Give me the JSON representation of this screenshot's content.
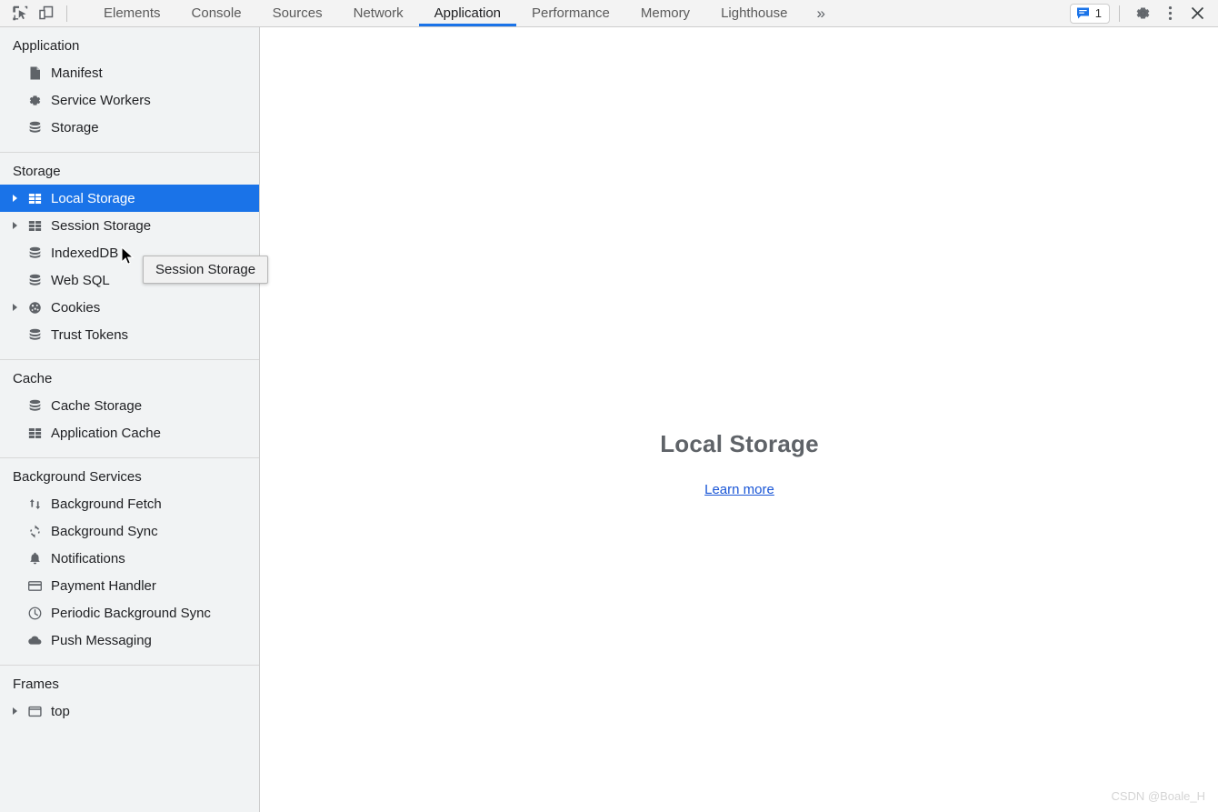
{
  "toolbar": {
    "inspect_icon": "inspect-element-icon",
    "device_icon": "device-toolbar-icon",
    "tabs": [
      {
        "label": "Elements",
        "active": false
      },
      {
        "label": "Console",
        "active": false
      },
      {
        "label": "Sources",
        "active": false
      },
      {
        "label": "Network",
        "active": false
      },
      {
        "label": "Application",
        "active": true
      },
      {
        "label": "Performance",
        "active": false
      },
      {
        "label": "Memory",
        "active": false
      },
      {
        "label": "Lighthouse",
        "active": false
      }
    ],
    "more_tabs_label": "»",
    "message_count": "1",
    "message_icon": "message-bubble-icon",
    "settings_icon": "gear-icon",
    "more_icon": "kebab-menu-icon",
    "close_icon": "close-icon",
    "accent_color": "#1a73e8"
  },
  "sidebar": {
    "sections": [
      {
        "title": "Application",
        "items": [
          {
            "label": "Manifest",
            "icon": "manifest-document-icon",
            "twisty": false,
            "selected": false
          },
          {
            "label": "Service Workers",
            "icon": "gear-icon",
            "twisty": false,
            "selected": false
          },
          {
            "label": "Storage",
            "icon": "database-stack-icon",
            "twisty": false,
            "selected": false
          }
        ]
      },
      {
        "title": "Storage",
        "items": [
          {
            "label": "Local Storage",
            "icon": "table-grid-icon",
            "twisty": true,
            "selected": true
          },
          {
            "label": "Session Storage",
            "icon": "table-grid-icon",
            "twisty": true,
            "selected": false
          },
          {
            "label": "IndexedDB",
            "icon": "database-stack-icon",
            "twisty": false,
            "selected": false
          },
          {
            "label": "Web SQL",
            "icon": "database-stack-icon",
            "twisty": false,
            "selected": false
          },
          {
            "label": "Cookies",
            "icon": "cookie-icon",
            "twisty": true,
            "selected": false
          },
          {
            "label": "Trust Tokens",
            "icon": "database-stack-icon",
            "twisty": false,
            "selected": false
          }
        ]
      },
      {
        "title": "Cache",
        "items": [
          {
            "label": "Cache Storage",
            "icon": "database-stack-icon",
            "twisty": false,
            "selected": false
          },
          {
            "label": "Application Cache",
            "icon": "table-grid-icon",
            "twisty": false,
            "selected": false
          }
        ]
      },
      {
        "title": "Background Services",
        "items": [
          {
            "label": "Background Fetch",
            "icon": "arrows-updown-icon",
            "twisty": false,
            "selected": false
          },
          {
            "label": "Background Sync",
            "icon": "sync-refresh-icon",
            "twisty": false,
            "selected": false
          },
          {
            "label": "Notifications",
            "icon": "bell-icon",
            "twisty": false,
            "selected": false
          },
          {
            "label": "Payment Handler",
            "icon": "credit-card-icon",
            "twisty": false,
            "selected": false
          },
          {
            "label": "Periodic Background Sync",
            "icon": "clock-icon",
            "twisty": false,
            "selected": false
          },
          {
            "label": "Push Messaging",
            "icon": "cloud-icon",
            "twisty": false,
            "selected": false
          }
        ]
      },
      {
        "title": "Frames",
        "items": [
          {
            "label": "top",
            "icon": "frame-window-icon",
            "twisty": true,
            "selected": false
          }
        ]
      }
    ],
    "selected_color": "#1a73e8"
  },
  "tooltip": {
    "text": "Session Storage"
  },
  "main": {
    "title": "Local Storage",
    "link_label": "Learn more",
    "link_color": "#1a56d6"
  },
  "watermark": {
    "text": "CSDN @Boale_H"
  }
}
